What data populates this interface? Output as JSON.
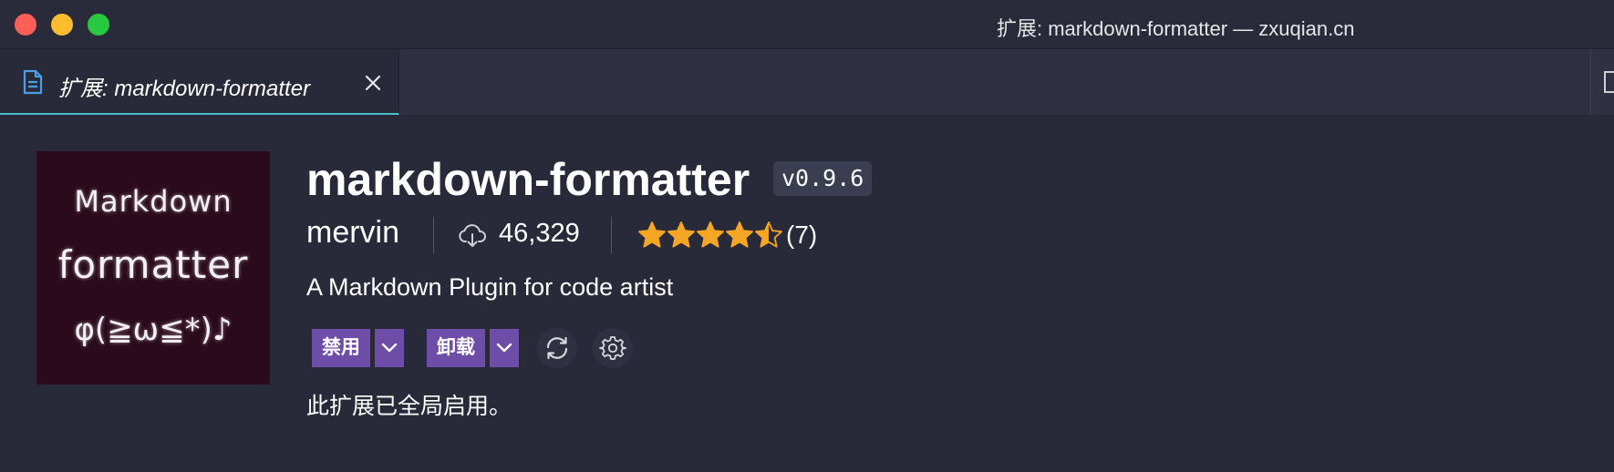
{
  "window": {
    "title": "扩展: markdown-formatter — zxuqian.cn"
  },
  "tabs": [
    {
      "label": "扩展: markdown-formatter",
      "active": true,
      "icon": "file-icon"
    }
  ],
  "extension": {
    "logo_lines": [
      "Markdown",
      "formatter",
      "φ(≧ω≦*)♪"
    ],
    "name": "markdown-formatter",
    "version": "v0.9.6",
    "publisher": "mervin",
    "installs": "46,329",
    "rating": 4.5,
    "rating_count": "(7)",
    "description": "A Markdown Plugin for code artist",
    "status_text": "此扩展已全局启用。"
  },
  "actions": {
    "disable_label": "禁用",
    "uninstall_label": "卸载",
    "dropdown_icon": "chevron-down-icon",
    "sync_icon": "sync-icon",
    "settings_icon": "gear-icon"
  },
  "colors": {
    "background": "#282a3a",
    "tab_active_border": "#46c0c8",
    "button_purple": "#6e4da8",
    "star_orange": "#f5a623",
    "logo_background": "#2b0b1b"
  }
}
